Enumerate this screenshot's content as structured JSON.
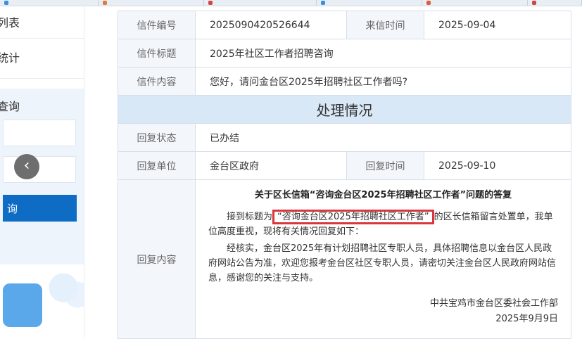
{
  "sidebar": {
    "list_label": "列表",
    "stats_label": "统计",
    "query_title": "查询",
    "query_btn": "询",
    "back_arrow": "‹"
  },
  "letter": {
    "number_label": "信件编号",
    "number": "2025090420526644",
    "date_label": "来信时间",
    "date": "2025-09-04",
    "title_label": "信件标题",
    "title": "2025年社区工作者招聘咨询",
    "content_label": "信件内容",
    "content": "您好，请问金台区2025年招聘社区工作者吗?"
  },
  "handling": {
    "section_title": "处理情况",
    "status_label": "回复状态",
    "status": "已办结",
    "unit_label": "回复单位",
    "unit": "金台区政府",
    "reply_date_label": "回复时间",
    "reply_date": "2025-09-10",
    "reply_label": "回复内容"
  },
  "reply": {
    "heading": "关于区长信箱“咨询金台区2025年招聘社区工作者”问题的答复",
    "p1_pre": "接到标题为",
    "p1_highlight": "“咨询金台区2025年招聘社区工作者”",
    "p1_post": "的区长信箱留言处置单，我单位高度重视，现将有关情况回复如下：",
    "p2": "经核实，金台区2025年有计划招聘社区专职人员，具体招聘信息以金台区人民政府网站公告为准，欢迎您报考金台区社区专职人员，请密切关注金台区人民政府网站信息，感谢您的关注与支持。",
    "sign_org": "中共宝鸡市金台区委社会工作部",
    "sign_date": "2025年9月9日"
  },
  "colors": {
    "primary": "#0e6cc4",
    "section_bg": "#d9e8f7",
    "label_bg": "#f3f7fc",
    "highlight_border": "#d9363e"
  }
}
